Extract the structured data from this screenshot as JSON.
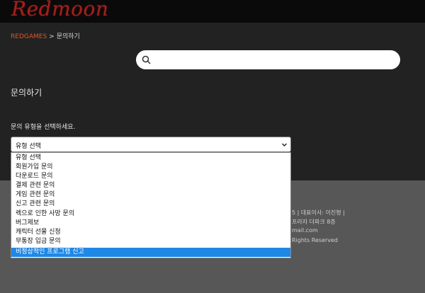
{
  "brand": {
    "logo_text": "Redmoon"
  },
  "breadcrumb": {
    "home": "REDGAMES",
    "separator": ">",
    "current": "문의하기"
  },
  "search": {
    "placeholder": "",
    "value": ""
  },
  "page": {
    "title": "문의하기",
    "prompt": "문의 유형을 선택하세요."
  },
  "inquiry_type": {
    "selected": "유형 선택",
    "options": [
      "유형 선택",
      "회원가입 문의",
      "다운로드 문의",
      "결제 관련 문의",
      "게임 관련 문의",
      "신고 관련 문의",
      "렉으로 인한 사망 문의",
      "버그제보",
      "캐릭터 선물 신청",
      "무통장 입금 문의",
      "비정상적인 프로그램 신고"
    ],
    "highlighted_index": 10
  },
  "footer": {
    "line1": "5 | 대표이사: 이진형 |",
    "line2": "프라자 더파크 8층",
    "line3": "mail.com",
    "line4": "Rights Reserved"
  },
  "colors": {
    "accent": "#e2532a",
    "highlight": "#1e88e5",
    "logo": "#a0221f"
  }
}
